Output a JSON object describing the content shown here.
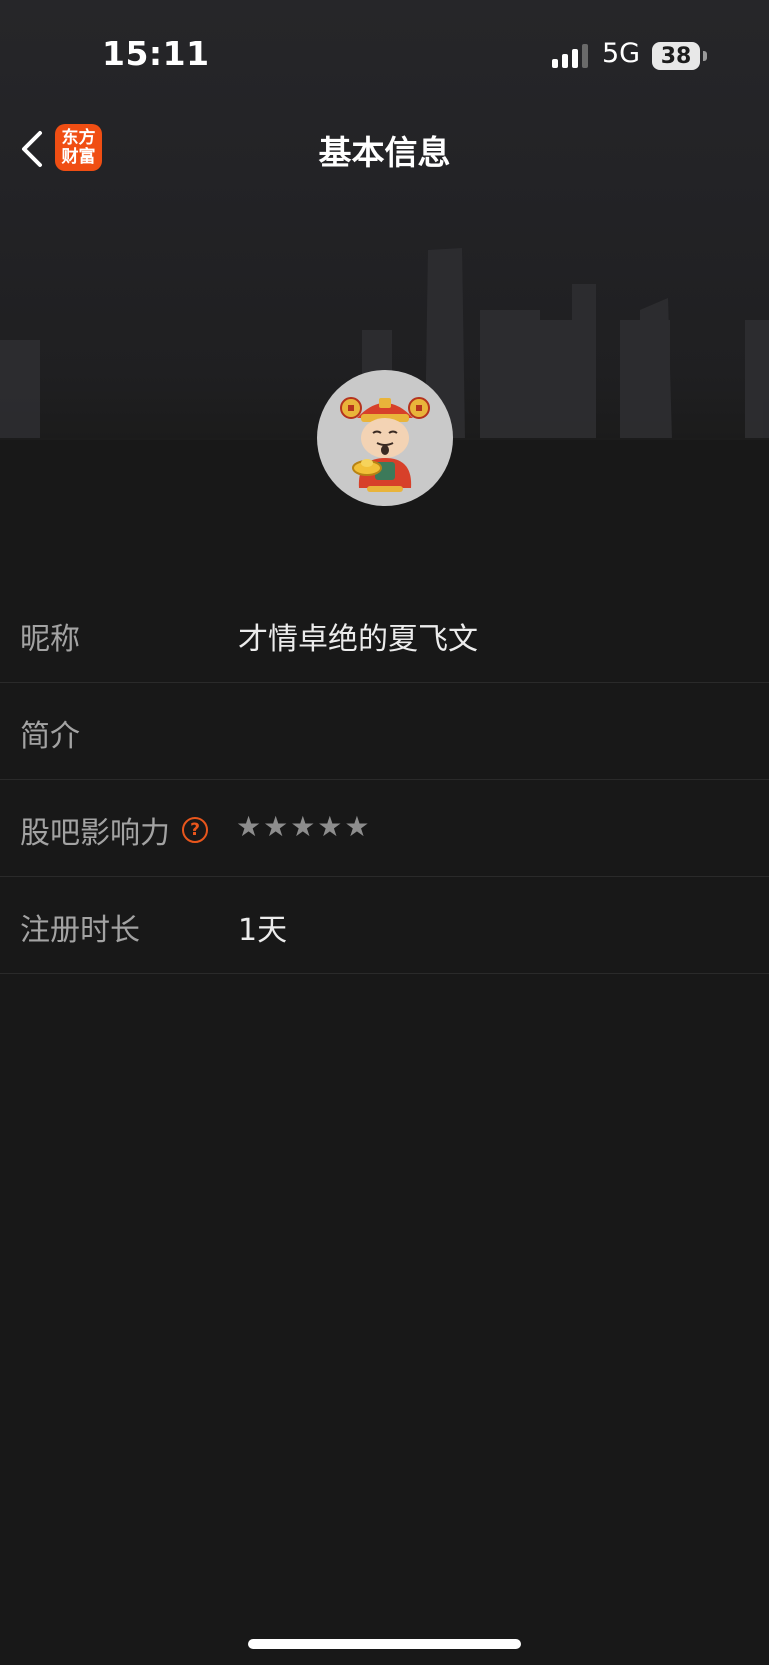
{
  "status_bar": {
    "time": "15:11",
    "network": "5G",
    "battery": "38",
    "signal_bars": 3
  },
  "nav": {
    "back_icon": "chevron-left-icon",
    "logo_lines": [
      "东方",
      "财富"
    ],
    "title": "基本信息"
  },
  "profile": {
    "avatar_icon": "god-of-wealth-avatar"
  },
  "rows": {
    "nickname": {
      "label": "昵称",
      "value": "才情卓绝的夏飞文"
    },
    "bio": {
      "label": "简介",
      "value": ""
    },
    "influence": {
      "label": "股吧影响力",
      "help_icon": "question-circle-icon",
      "stars": "★★★★★",
      "rating": 0
    },
    "register": {
      "label": "注册时长",
      "value": "1天"
    }
  },
  "colors": {
    "background": "#181818",
    "accent": "#e8561c",
    "logo_bg": "#f04e13",
    "label": "#a3a3a3",
    "value": "#ececec"
  }
}
